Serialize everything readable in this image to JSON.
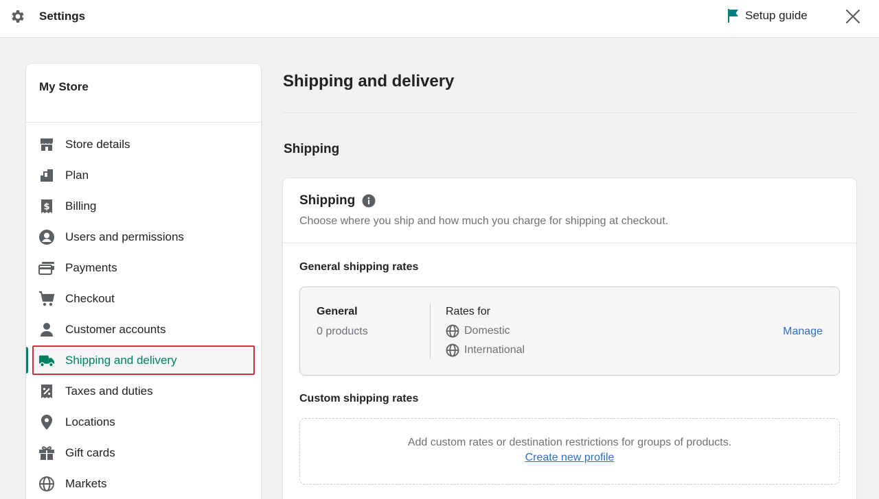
{
  "topbar": {
    "title": "Settings",
    "setup_label": "Setup guide"
  },
  "colors": {
    "accent": "#008060",
    "link": "#2c6ecb",
    "highlight_border": "#d82c3d",
    "flag": "#008080"
  },
  "sidebar": {
    "store_name": "My Store",
    "items": [
      {
        "label": "Store details",
        "icon": "store-icon"
      },
      {
        "label": "Plan",
        "icon": "plan-icon"
      },
      {
        "label": "Billing",
        "icon": "billing-icon"
      },
      {
        "label": "Users and permissions",
        "icon": "user-circle-icon"
      },
      {
        "label": "Payments",
        "icon": "payments-icon"
      },
      {
        "label": "Checkout",
        "icon": "cart-icon"
      },
      {
        "label": "Customer accounts",
        "icon": "person-icon"
      },
      {
        "label": "Shipping and delivery",
        "icon": "truck-icon",
        "active": true
      },
      {
        "label": "Taxes and duties",
        "icon": "tax-icon"
      },
      {
        "label": "Locations",
        "icon": "location-pin-icon"
      },
      {
        "label": "Gift cards",
        "icon": "gift-icon"
      },
      {
        "label": "Markets",
        "icon": "globe-icon"
      }
    ]
  },
  "main": {
    "page_title": "Shipping and delivery",
    "section_title": "Shipping",
    "card": {
      "title": "Shipping",
      "description": "Choose where you ship and how much you charge for shipping at checkout.",
      "general_rates_title": "General shipping rates",
      "general": {
        "name": "General",
        "count": "0 products",
        "rates_for": "Rates for",
        "domestic": "Domestic",
        "international": "International",
        "manage": "Manage"
      },
      "custom_rates_title": "Custom shipping rates",
      "custom": {
        "text": "Add custom rates or destination restrictions for groups of products.",
        "link": "Create new profile"
      }
    }
  }
}
